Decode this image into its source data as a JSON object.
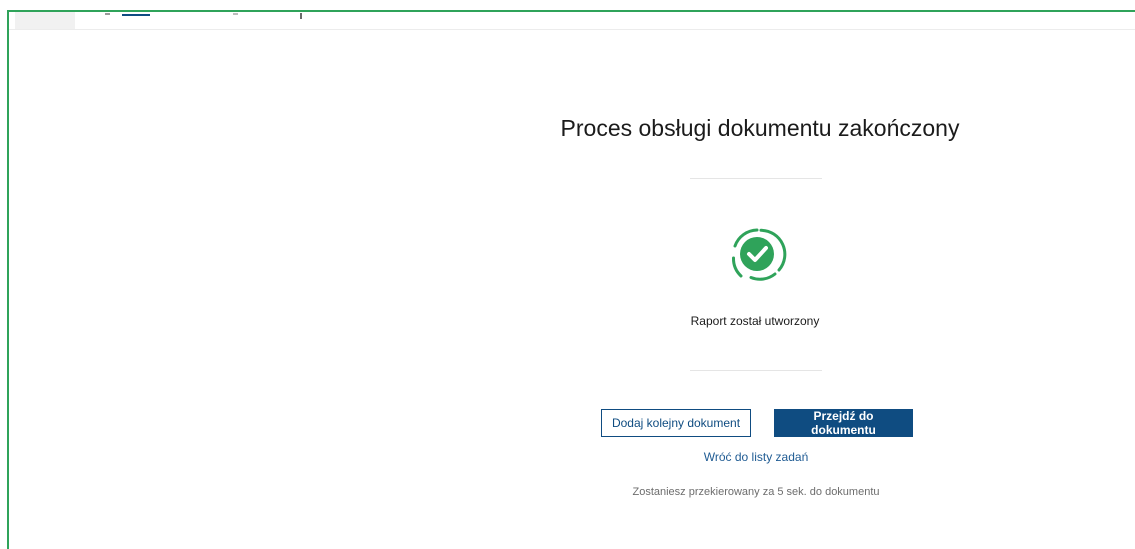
{
  "header": {
    "title": "Proces obsługi dokumentu zakończony"
  },
  "status": {
    "icon": "check-circle-icon",
    "message": "Raport został utworzony",
    "color": "#2fa35a"
  },
  "actions": {
    "add_another_label": "Dodaj kolejny dokument",
    "go_to_document_label": "Przejdź do dokumentu",
    "back_link_label": "Wróć do listy zadań"
  },
  "redirect_note": "Zostaniesz przekierowany za 5 sek. do dokumentu",
  "colors": {
    "primary": "#0f4c81",
    "success": "#2fa35a",
    "frame": "#2fa35a"
  }
}
